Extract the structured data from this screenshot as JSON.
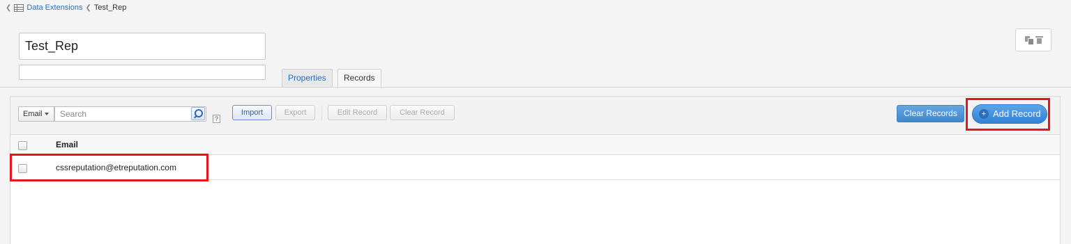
{
  "breadcrumb": {
    "separator": "❮",
    "icon": "table-icon",
    "link_label": "Data Extensions",
    "current": "Test_Rep"
  },
  "extension": {
    "name_value": "Test_Rep",
    "description_value": ""
  },
  "tabs": [
    {
      "label": "Properties",
      "active": false
    },
    {
      "label": "Records",
      "active": true
    }
  ],
  "header_actions": {
    "copy_icon": "copy-icon",
    "delete_icon": "trash-icon"
  },
  "toolbar": {
    "field_select": "Email",
    "search_placeholder": "Search",
    "help_label": "?",
    "import_label": "Import",
    "export_label": "Export",
    "edit_record_label": "Edit Record",
    "clear_record_label": "Clear Record",
    "clear_records_label": "Clear Records",
    "add_record_plus": "+",
    "add_record_label": "Add Record"
  },
  "table": {
    "columns": [
      "Email"
    ],
    "rows": [
      {
        "email": "cssreputation@etreputation.com"
      }
    ]
  },
  "colors": {
    "link": "#2a6ebb",
    "primary_button": "#3f86cc",
    "highlight": "#e8141d"
  }
}
